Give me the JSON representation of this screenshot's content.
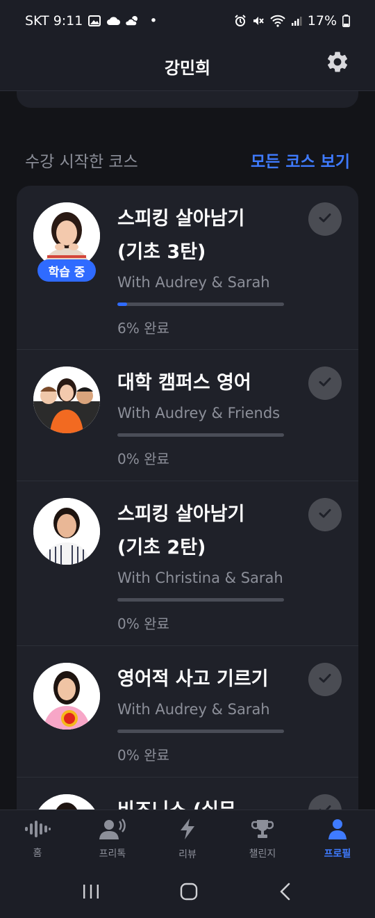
{
  "status_bar": {
    "carrier_time": "SKT 9:11",
    "dot": "•",
    "battery": "17%"
  },
  "header": {
    "title": "강민희"
  },
  "section": {
    "title": "수강 시작한 코스",
    "see_all": "모든 코스 보기"
  },
  "courses": [
    {
      "title_line1": "스피킹 살아남기",
      "title_line2": "(기초 3탄)",
      "with": "With Audrey & Sarah",
      "progress": 6,
      "progress_label": "6% 완료",
      "badge": "학습 중"
    },
    {
      "title_line1": "대학 캠퍼스 영어",
      "title_line2": "",
      "with": "With Audrey & Friends",
      "progress": 0,
      "progress_label": "0% 완료"
    },
    {
      "title_line1": "스피킹 살아남기",
      "title_line2": "(기초 2탄)",
      "with": "With Christina & Sarah",
      "progress": 0,
      "progress_label": "0% 완료"
    },
    {
      "title_line1": "영어적 사고 기르기",
      "title_line2": "",
      "with": "With Audrey & Sarah",
      "progress": 0,
      "progress_label": "0% 완료"
    },
    {
      "title_line1": "비즈니스 (실무",
      "title_line2": "",
      "with": "",
      "progress": 0,
      "progress_label": ""
    }
  ],
  "bottom_nav": [
    {
      "label": "홈",
      "icon": "waveform-icon",
      "active": false
    },
    {
      "label": "프리톡",
      "icon": "speaking-person-icon",
      "active": false
    },
    {
      "label": "리뷰",
      "icon": "lightning-icon",
      "active": false
    },
    {
      "label": "챌린지",
      "icon": "trophy-icon",
      "active": false
    },
    {
      "label": "프로필",
      "icon": "person-icon",
      "active": true
    }
  ],
  "colors": {
    "accent": "#3f7bff",
    "background": "#131418",
    "card": "#1f2129"
  }
}
